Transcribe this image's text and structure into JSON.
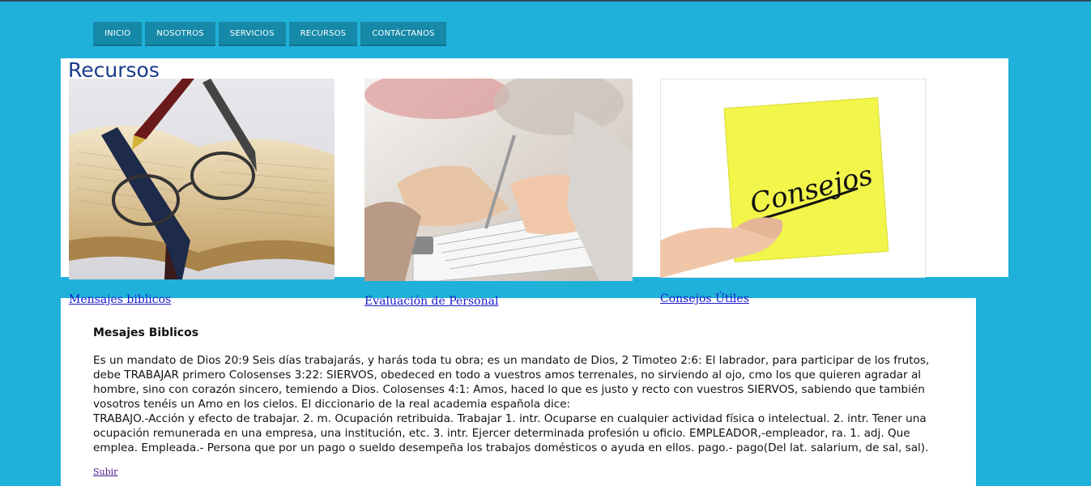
{
  "nav": {
    "items": [
      {
        "label": "INICIO"
      },
      {
        "label": "NOSOTROS"
      },
      {
        "label": "SERVICIOS"
      },
      {
        "label": "RECURSOS"
      },
      {
        "label": "CONTÁCTANOS"
      }
    ]
  },
  "page": {
    "title": "Recursos"
  },
  "cards": [
    {
      "link": "Mensajes biblicos",
      "image": "bible-glasses-pen-photo"
    },
    {
      "link": "Evaluación de Personal",
      "image": "people-writing-clipboard-photo"
    },
    {
      "link": "Consejos Útiles",
      "image": "sticky-note-consejos-photo",
      "note_text": "Consejos"
    }
  ],
  "section": {
    "title": "Mesajes Biblicos",
    "paragraph1": "Es un mandato de Dios 20:9 Seis días trabajarás, y harás toda tu obra; es un mandato de Dios, 2 Timoteo 2:6: El labrador, para participar de los frutos, debe TRABAJAR primero Colosenses 3:22: SIERVOS, obedeced en todo a vuestros amos terrenales, no sirviendo al ojo, cmo los que quieren agradar al hombre, sino con corazón sincero, temiendo a Dios. Colosenses 4:1: Amos, haced lo que es justo y recto con vuestros SIERVOS, sabiendo que también vosotros tenéis un Amo en los cielos. El diccionario de la real academia española dice:",
    "paragraph2": "TRABAJO.-Acción y efecto de trabajar. 2. m. Ocupación retribuida. Trabajar 1. intr. Ocuparse en cualquier actividad física o intelectual. 2. intr. Tener una ocupación remunerada en una empresa, una institución, etc. 3. intr. Ejercer determinada profesión u oficio. EMPLEADOR,-empleador, ra. 1. adj. Que emplea. Empleada.- Persona que por un pago o sueldo desempeña los trabajos domésticos o ayuda en ellos. pago.- pago(Del lat. salarium, de sal, sal).",
    "back_to_top": "Subir"
  },
  "colors": {
    "background": "#1fb1d9",
    "nav_button": "#1688a8",
    "title": "#1a3a8c",
    "link": "#1a1acc"
  }
}
